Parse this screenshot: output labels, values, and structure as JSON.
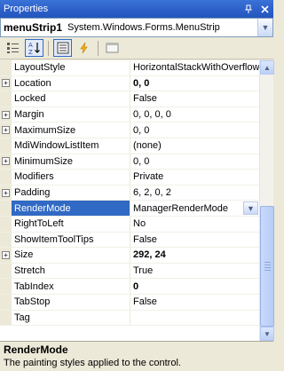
{
  "window": {
    "title": "Properties"
  },
  "object_selector": {
    "name": "menuStrip1",
    "type": "System.Windows.Forms.MenuStrip"
  },
  "properties": [
    {
      "name": "LayoutStyle",
      "value": "HorizontalStackWithOverflow",
      "expandable": false,
      "bold": false
    },
    {
      "name": "Location",
      "value": "0, 0",
      "expandable": true,
      "bold": true
    },
    {
      "name": "Locked",
      "value": "False",
      "expandable": false,
      "bold": false
    },
    {
      "name": "Margin",
      "value": "0, 0, 0, 0",
      "expandable": true,
      "bold": false
    },
    {
      "name": "MaximumSize",
      "value": "0, 0",
      "expandable": true,
      "bold": false
    },
    {
      "name": "MdiWindowListItem",
      "value": "(none)",
      "expandable": false,
      "bold": false
    },
    {
      "name": "MinimumSize",
      "value": "0, 0",
      "expandable": true,
      "bold": false
    },
    {
      "name": "Modifiers",
      "value": "Private",
      "expandable": false,
      "bold": false
    },
    {
      "name": "Padding",
      "value": "6, 2, 0, 2",
      "expandable": true,
      "bold": false
    },
    {
      "name": "RenderMode",
      "value": "ManagerRenderMode",
      "expandable": false,
      "bold": false,
      "selected": true
    },
    {
      "name": "RightToLeft",
      "value": "No",
      "expandable": false,
      "bold": false
    },
    {
      "name": "ShowItemToolTips",
      "value": "False",
      "expandable": false,
      "bold": false
    },
    {
      "name": "Size",
      "value": "292, 24",
      "expandable": true,
      "bold": true
    },
    {
      "name": "Stretch",
      "value": "True",
      "expandable": false,
      "bold": false
    },
    {
      "name": "TabIndex",
      "value": "0",
      "expandable": false,
      "bold": true
    },
    {
      "name": "TabStop",
      "value": "False",
      "expandable": false,
      "bold": false
    },
    {
      "name": "Tag",
      "value": "",
      "expandable": false,
      "bold": false
    }
  ],
  "description": {
    "title": "RenderMode",
    "text": "The painting styles applied to the control."
  },
  "icons": {
    "categorized": "categorized-icon",
    "alphabetical": "alphabetical-icon",
    "properties": "properties-icon",
    "events": "events-icon",
    "property_pages": "property-pages-icon"
  },
  "colors": {
    "title_bar": "#2c5fc8",
    "selection": "#316ac5",
    "panel": "#ece9d8"
  }
}
